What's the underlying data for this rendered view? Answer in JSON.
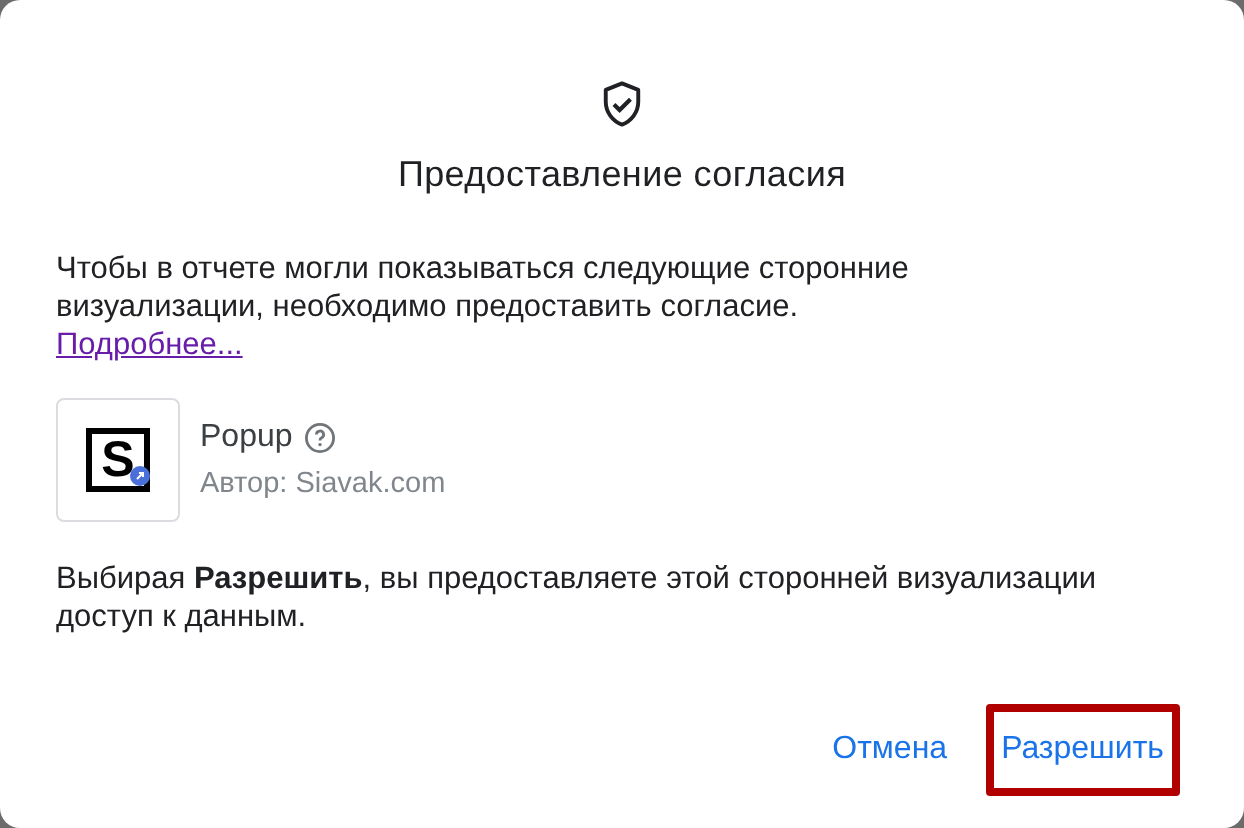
{
  "dialog": {
    "title": "Предоставление согласия",
    "intro": "Чтобы в отчете могли показываться следующие сторонние визуализации, необходимо предоставить согласие.",
    "more_link": "Подробнее...",
    "visualization": {
      "name": "Popup",
      "author": "Автор: Siavak.com",
      "logo_letter": "S"
    },
    "consent": "Выбирая **Разрешить**, вы предоставляете этой сторонней визуализации доступ к данным.",
    "buttons": [
      {
        "label": "Отмена",
        "highlighted": false
      },
      {
        "label": "Разрешить",
        "highlighted": true
      }
    ]
  }
}
